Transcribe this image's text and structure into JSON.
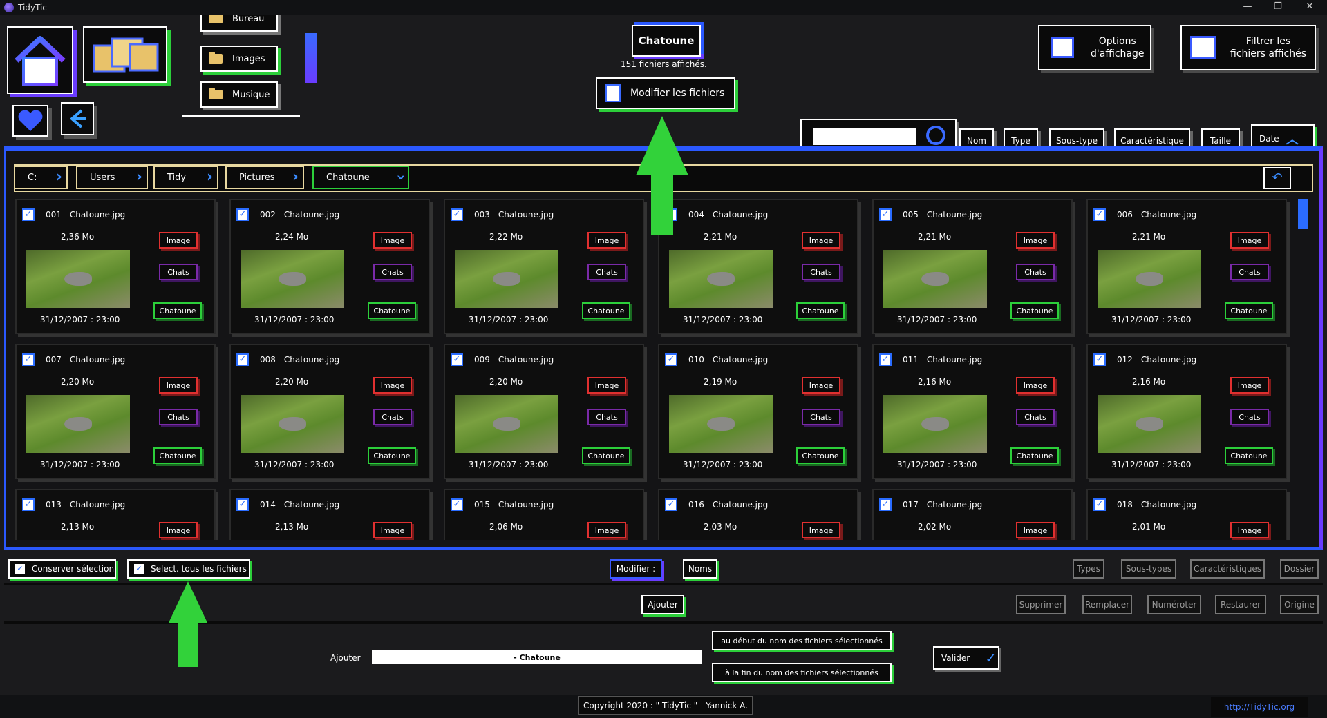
{
  "window": {
    "title": "TidyTic",
    "minimize": "—",
    "restore": "❐",
    "close": "✕"
  },
  "nav": {
    "folders": [
      "Bureau",
      "Images",
      "Musique"
    ]
  },
  "current": {
    "folder": "Chatoune",
    "count_text": "151 fichiers affichés.",
    "edit_button": "Modifier les fichiers"
  },
  "top_right": {
    "options_line1": "Options",
    "options_line2": "d'affichage",
    "filter_line1": "Filtrer les",
    "filter_line2": "fichiers affichés"
  },
  "sort": {
    "search_placeholder": "",
    "buttons": [
      "Nom",
      "Type",
      "Sous-type",
      "Caractéristique",
      "Taille",
      "Date"
    ]
  },
  "breadcrumb": [
    "C:",
    "Users",
    "Tidy",
    "Pictures",
    "Chatoune"
  ],
  "files": [
    {
      "check": "✓",
      "name": "001 - Chatoune.jpg",
      "size": "2,36 Mo",
      "date": "31/12/2007 : 23:00",
      "type": "Image",
      "subtype": "Chats",
      "feature": "Chatoune"
    },
    {
      "check": "✓",
      "name": "002 - Chatoune.jpg",
      "size": "2,24 Mo",
      "date": "31/12/2007 : 23:00",
      "type": "Image",
      "subtype": "Chats",
      "feature": "Chatoune"
    },
    {
      "check": "✓",
      "name": "003 - Chatoune.jpg",
      "size": "2,22 Mo",
      "date": "31/12/2007 : 23:00",
      "type": "Image",
      "subtype": "Chats",
      "feature": "Chatoune"
    },
    {
      "check": "✓",
      "name": "004 - Chatoune.jpg",
      "size": "2,21 Mo",
      "date": "31/12/2007 : 23:00",
      "type": "Image",
      "subtype": "Chats",
      "feature": "Chatoune"
    },
    {
      "check": "✓",
      "name": "005 - Chatoune.jpg",
      "size": "2,21 Mo",
      "date": "31/12/2007 : 23:00",
      "type": "Image",
      "subtype": "Chats",
      "feature": "Chatoune"
    },
    {
      "check": "✓",
      "name": "006 - Chatoune.jpg",
      "size": "2,21 Mo",
      "date": "31/12/2007 : 23:00",
      "type": "Image",
      "subtype": "Chats",
      "feature": "Chatoune"
    },
    {
      "check": "✓",
      "name": "007 - Chatoune.jpg",
      "size": "2,20 Mo",
      "date": "31/12/2007 : 23:00",
      "type": "Image",
      "subtype": "Chats",
      "feature": "Chatoune"
    },
    {
      "check": "✓",
      "name": "008 - Chatoune.jpg",
      "size": "2,20 Mo",
      "date": "31/12/2007 : 23:00",
      "type": "Image",
      "subtype": "Chats",
      "feature": "Chatoune"
    },
    {
      "check": "✓",
      "name": "009 - Chatoune.jpg",
      "size": "2,20 Mo",
      "date": "31/12/2007 : 23:00",
      "type": "Image",
      "subtype": "Chats",
      "feature": "Chatoune"
    },
    {
      "check": "✓",
      "name": "010 - Chatoune.jpg",
      "size": "2,19 Mo",
      "date": "31/12/2007 : 23:00",
      "type": "Image",
      "subtype": "Chats",
      "feature": "Chatoune"
    },
    {
      "check": "✓",
      "name": "011 - Chatoune.jpg",
      "size": "2,16 Mo",
      "date": "31/12/2007 : 23:00",
      "type": "Image",
      "subtype": "Chats",
      "feature": "Chatoune"
    },
    {
      "check": "✓",
      "name": "012 - Chatoune.jpg",
      "size": "2,16 Mo",
      "date": "31/12/2007 : 23:00",
      "type": "Image",
      "subtype": "Chats",
      "feature": "Chatoune"
    },
    {
      "check": "✓",
      "name": "013 - Chatoune.jpg",
      "size": "2,13 Mo",
      "date": "",
      "type": "Image",
      "subtype": "",
      "feature": ""
    },
    {
      "check": "✓",
      "name": "014 - Chatoune.jpg",
      "size": "2,13 Mo",
      "date": "",
      "type": "Image",
      "subtype": "",
      "feature": ""
    },
    {
      "check": "✓",
      "name": "015 - Chatoune.jpg",
      "size": "2,06 Mo",
      "date": "",
      "type": "Image",
      "subtype": "",
      "feature": ""
    },
    {
      "check": "✓",
      "name": "016 - Chatoune.jpg",
      "size": "2,03 Mo",
      "date": "",
      "type": "Image",
      "subtype": "",
      "feature": ""
    },
    {
      "check": "✓",
      "name": "017 - Chatoune.jpg",
      "size": "2,02 Mo",
      "date": "",
      "type": "Image",
      "subtype": "",
      "feature": ""
    },
    {
      "check": "✓",
      "name": "018 - Chatoune.jpg",
      "size": "2,01 Mo",
      "date": "",
      "type": "Image",
      "subtype": "",
      "feature": ""
    }
  ],
  "bottom": {
    "keep_selection": "Conserver sélection",
    "select_all": "Select. tous les fichiers",
    "modify_label": "Modifier :",
    "modes": [
      "Noms",
      "Types",
      "Sous-types",
      "Caractéristiques",
      "Dossier"
    ],
    "actions": [
      "Ajouter",
      "Supprimer",
      "Remplacer",
      "Numéroter",
      "Restaurer",
      "Origine"
    ],
    "add_label": "Ajouter",
    "add_value": "- Chatoune",
    "at_start": "au début du nom des fichiers sélectionnés",
    "at_end": "à la fin du nom des fichiers sélectionnés",
    "validate": "Valider"
  },
  "footer": {
    "copyright": "Copyright 2020 : \" TidyTic \" - Yannick A.",
    "link": "http://TidyTic.org"
  },
  "colors": {
    "accent_blue": "#2b59ff",
    "accent_purple": "#6a3cff",
    "green": "#2ccf3a",
    "red": "#e03030"
  }
}
